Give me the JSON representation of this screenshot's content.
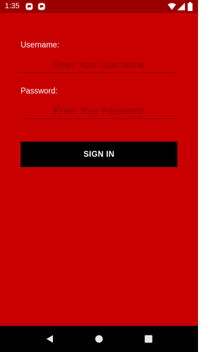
{
  "status_bar": {
    "time": "1:35",
    "notifications": [
      "chat-notification-icon",
      "chat-notification-icon"
    ],
    "right_icons": [
      "wifi-icon",
      "cellular-signal-icon",
      "battery-icon"
    ]
  },
  "form": {
    "username": {
      "label": "Username:",
      "placeholder": "Enter Your Username",
      "value": ""
    },
    "password": {
      "label": "Password:",
      "placeholder": "Enter Your Password",
      "value": ""
    },
    "sign_in_label": "SIGN IN"
  },
  "nav_bar": {
    "buttons": [
      "back-icon",
      "home-icon",
      "recents-icon"
    ]
  },
  "colors": {
    "background": "#c90000",
    "status_bar": "#9b0000",
    "button": "#000000",
    "button_text": "#ffffff"
  }
}
